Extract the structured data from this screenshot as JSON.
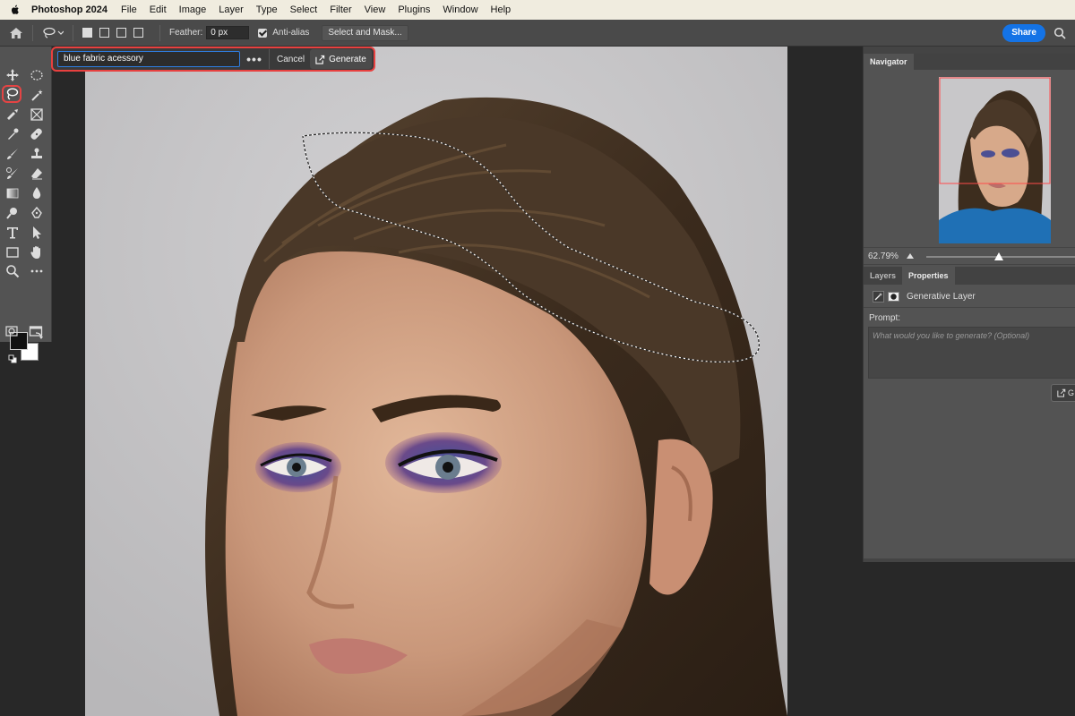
{
  "menubar": {
    "app_name": "Photoshop 2024",
    "items": [
      "File",
      "Edit",
      "Image",
      "Layer",
      "Type",
      "Select",
      "Filter",
      "View",
      "Plugins",
      "Window",
      "Help"
    ]
  },
  "options_bar": {
    "feather_label": "Feather:",
    "feather_value": "0 px",
    "anti_alias_label": "Anti-alias",
    "anti_alias_checked": true,
    "select_mask_label": "Select and Mask...",
    "share_label": "Share"
  },
  "contextual_bar": {
    "prompt_value": "blue fabric acessory",
    "more_label": "•••",
    "cancel_label": "Cancel",
    "generate_label": "Generate"
  },
  "navigator": {
    "tab_label": "Navigator",
    "zoom": "62.79%"
  },
  "panel_tabs": {
    "layers": "Layers",
    "properties": "Properties"
  },
  "properties": {
    "layer_type": "Generative Layer",
    "prompt_label": "Prompt:",
    "prompt_placeholder": "What would you like to generate? (Optional)",
    "generate_short": "G"
  },
  "colors": {
    "accent": "#1473e6",
    "highlight": "#e8403f",
    "panel": "#535353",
    "app_bg": "#282828"
  }
}
